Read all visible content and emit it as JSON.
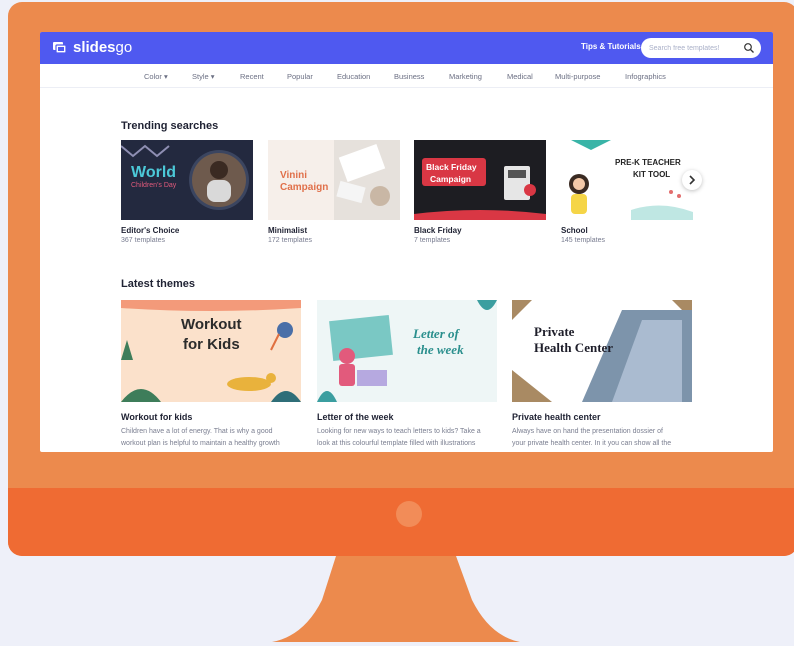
{
  "brand": {
    "name": "slidesgo",
    "name_bold": "slides",
    "name_light": "go",
    "accent": "#4f59f0",
    "monitor_color": "#ec8a4d",
    "chin_color": "#ef6b33"
  },
  "header": {
    "tips_label": "Tips & Tutorials",
    "search_placeholder": "Search free templates!",
    "search_icon": "search-icon"
  },
  "nav": {
    "items": [
      {
        "label": "Color",
        "dropdown": true
      },
      {
        "label": "Style",
        "dropdown": true
      },
      {
        "label": "Recent"
      },
      {
        "label": "Popular"
      },
      {
        "label": "Education"
      },
      {
        "label": "Business"
      },
      {
        "label": "Marketing"
      },
      {
        "label": "Medical"
      },
      {
        "label": "Multi-purpose"
      },
      {
        "label": "Infographics"
      }
    ]
  },
  "trending": {
    "title": "Trending searches",
    "cards": [
      {
        "name": "Editor's Choice",
        "count": "367 templates",
        "thumb_line1": "World",
        "thumb_line2": "Children's Day"
      },
      {
        "name": "Minimalist",
        "count": "172 templates",
        "thumb_line1": "Vinini",
        "thumb_line2": "Campaign"
      },
      {
        "name": "Black Friday",
        "count": "7 templates",
        "thumb_line1": "Black Friday",
        "thumb_line2": "Campaign"
      },
      {
        "name": "School",
        "count": "145 templates",
        "thumb_line1": "PRE-K TEACHER",
        "thumb_line2": "KIT TOOL"
      }
    ],
    "next_icon": "chevron-right-icon"
  },
  "latest": {
    "title": "Latest themes",
    "cards": [
      {
        "title": "Workout for kids",
        "desc_line1": "Children have a lot of energy. That is why a good",
        "desc_line2": "workout plan is helpful to maintain a healthy growth",
        "thumb_line1": "Workout",
        "thumb_line2": "for Kids"
      },
      {
        "title": "Letter of the week",
        "desc_line1": "Looking for new ways to teach letters to kids? Take a",
        "desc_line2": "look at this colourful template filled with illustrations",
        "thumb_line1": "Letter of",
        "thumb_line2": "the week"
      },
      {
        "title": "Private health center",
        "desc_line1": "Always have on hand the presentation dossier of",
        "desc_line2": "your private health center. In it you can show all the",
        "thumb_line1": "Private",
        "thumb_line2": "Health Center"
      }
    ]
  }
}
